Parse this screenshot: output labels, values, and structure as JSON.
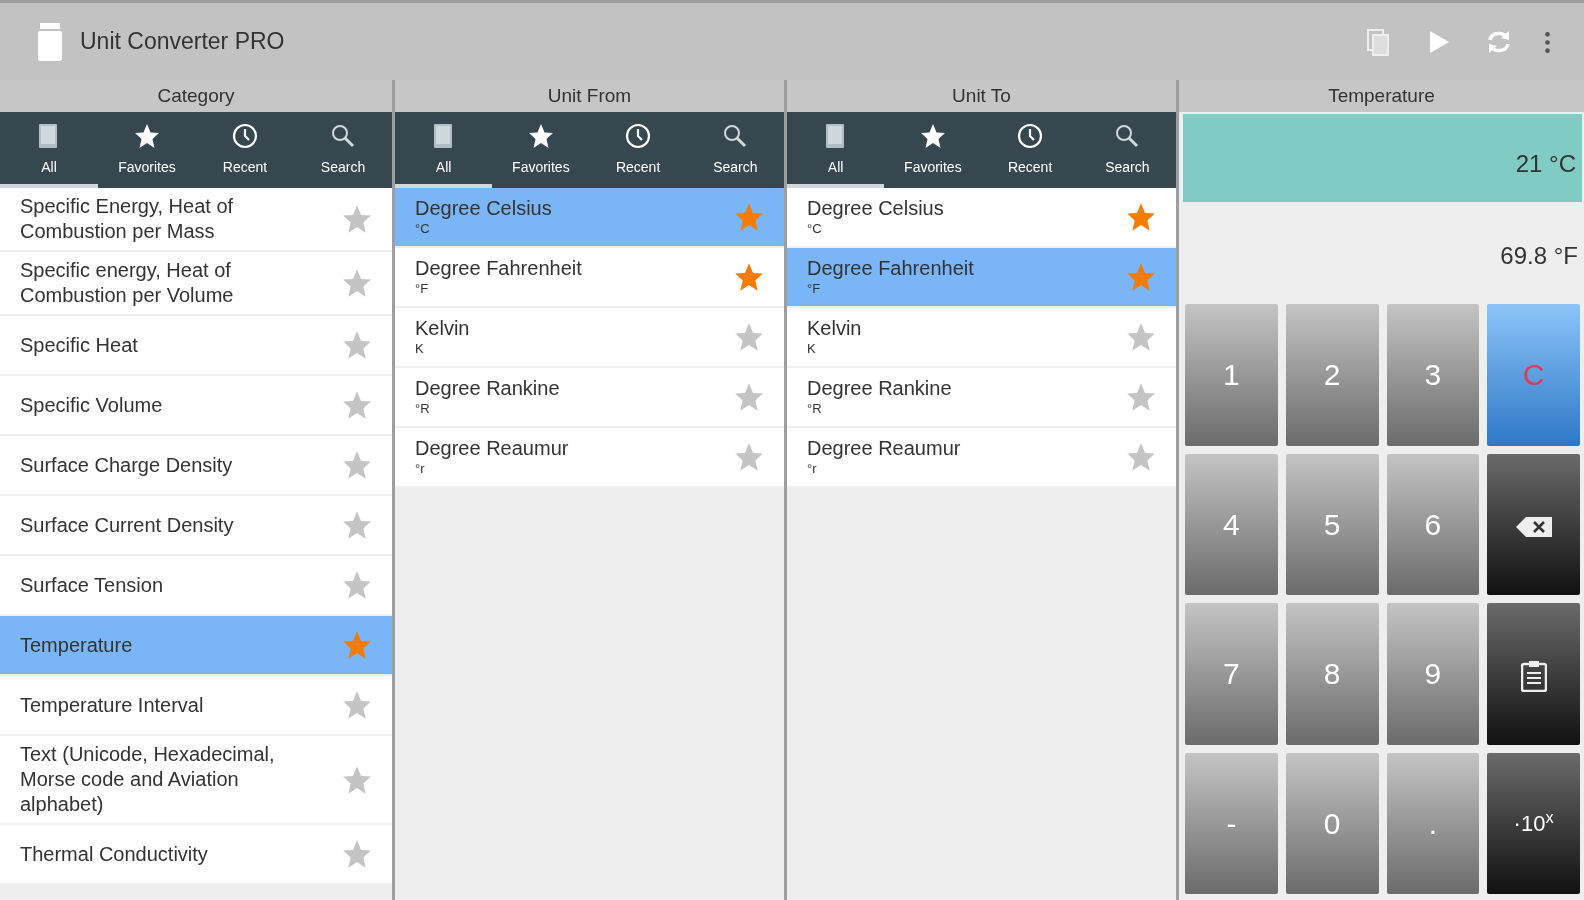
{
  "app_bar": {
    "title": "Unit Converter PRO"
  },
  "panels": [
    {
      "header": "Category",
      "tabs": [
        {
          "label": "All",
          "selected": true
        },
        {
          "label": "Favorites",
          "selected": false
        },
        {
          "label": "Recent",
          "selected": false
        },
        {
          "label": "Search",
          "selected": false
        }
      ],
      "items": [
        {
          "name": "Specific Energy, Heat of Combustion per Mass",
          "favorite": false,
          "selected": false
        },
        {
          "name": "Specific energy, Heat of Combustion per Volume",
          "favorite": false,
          "selected": false
        },
        {
          "name": "Specific Heat",
          "favorite": false,
          "selected": false
        },
        {
          "name": "Specific Volume",
          "favorite": false,
          "selected": false
        },
        {
          "name": "Surface Charge Density",
          "favorite": false,
          "selected": false
        },
        {
          "name": "Surface Current Density",
          "favorite": false,
          "selected": false
        },
        {
          "name": "Surface Tension",
          "favorite": false,
          "selected": false
        },
        {
          "name": "Temperature",
          "favorite": true,
          "selected": true
        },
        {
          "name": "Temperature Interval",
          "favorite": false,
          "selected": false
        },
        {
          "name": "Text (Unicode, Hexadecimal, Morse code and Aviation alphabet)",
          "favorite": false,
          "selected": false
        },
        {
          "name": "Thermal Conductivity",
          "favorite": false,
          "selected": false
        }
      ]
    },
    {
      "header": "Unit From",
      "tabs": [
        {
          "label": "All",
          "selected": true
        },
        {
          "label": "Favorites",
          "selected": false
        },
        {
          "label": "Recent",
          "selected": false
        },
        {
          "label": "Search",
          "selected": false
        }
      ],
      "items": [
        {
          "name": "Degree Celsius",
          "symbol": "°C",
          "favorite": true,
          "selected": true
        },
        {
          "name": "Degree Fahrenheit",
          "symbol": "°F",
          "favorite": true,
          "selected": false
        },
        {
          "name": "Kelvin",
          "symbol": "K",
          "favorite": false,
          "selected": false
        },
        {
          "name": "Degree Rankine",
          "symbol": "°R",
          "favorite": false,
          "selected": false
        },
        {
          "name": "Degree Reaumur",
          "symbol": "°r",
          "favorite": false,
          "selected": false
        }
      ]
    },
    {
      "header": "Unit To",
      "tabs": [
        {
          "label": "All",
          "selected": true
        },
        {
          "label": "Favorites",
          "selected": false
        },
        {
          "label": "Recent",
          "selected": false
        },
        {
          "label": "Search",
          "selected": false
        }
      ],
      "items": [
        {
          "name": "Degree Celsius",
          "symbol": "°C",
          "favorite": true,
          "selected": false
        },
        {
          "name": "Degree Fahrenheit",
          "symbol": "°F",
          "favorite": true,
          "selected": true
        },
        {
          "name": "Kelvin",
          "symbol": "K",
          "favorite": false,
          "selected": false
        },
        {
          "name": "Degree Rankine",
          "symbol": "°R",
          "favorite": false,
          "selected": false
        },
        {
          "name": "Degree Reaumur",
          "symbol": "°r",
          "favorite": false,
          "selected": false
        }
      ]
    }
  ],
  "calculator": {
    "header": "Temperature",
    "input": "21 °C",
    "result": "69.8 °F",
    "keys": [
      {
        "label": "1",
        "kind": "digit"
      },
      {
        "label": "2",
        "kind": "digit"
      },
      {
        "label": "3",
        "kind": "digit"
      },
      {
        "label": "C",
        "kind": "clear"
      },
      {
        "label": "4",
        "kind": "digit"
      },
      {
        "label": "5",
        "kind": "digit"
      },
      {
        "label": "6",
        "kind": "digit"
      },
      {
        "kind": "backspace"
      },
      {
        "label": "7",
        "kind": "digit"
      },
      {
        "label": "8",
        "kind": "digit"
      },
      {
        "label": "9",
        "kind": "digit"
      },
      {
        "kind": "paste"
      },
      {
        "label": "-",
        "kind": "digit"
      },
      {
        "label": "0",
        "kind": "digit"
      },
      {
        "label": ".",
        "kind": "digit"
      },
      {
        "label": "·10$^{x}$",
        "kind": "exponent"
      }
    ]
  }
}
